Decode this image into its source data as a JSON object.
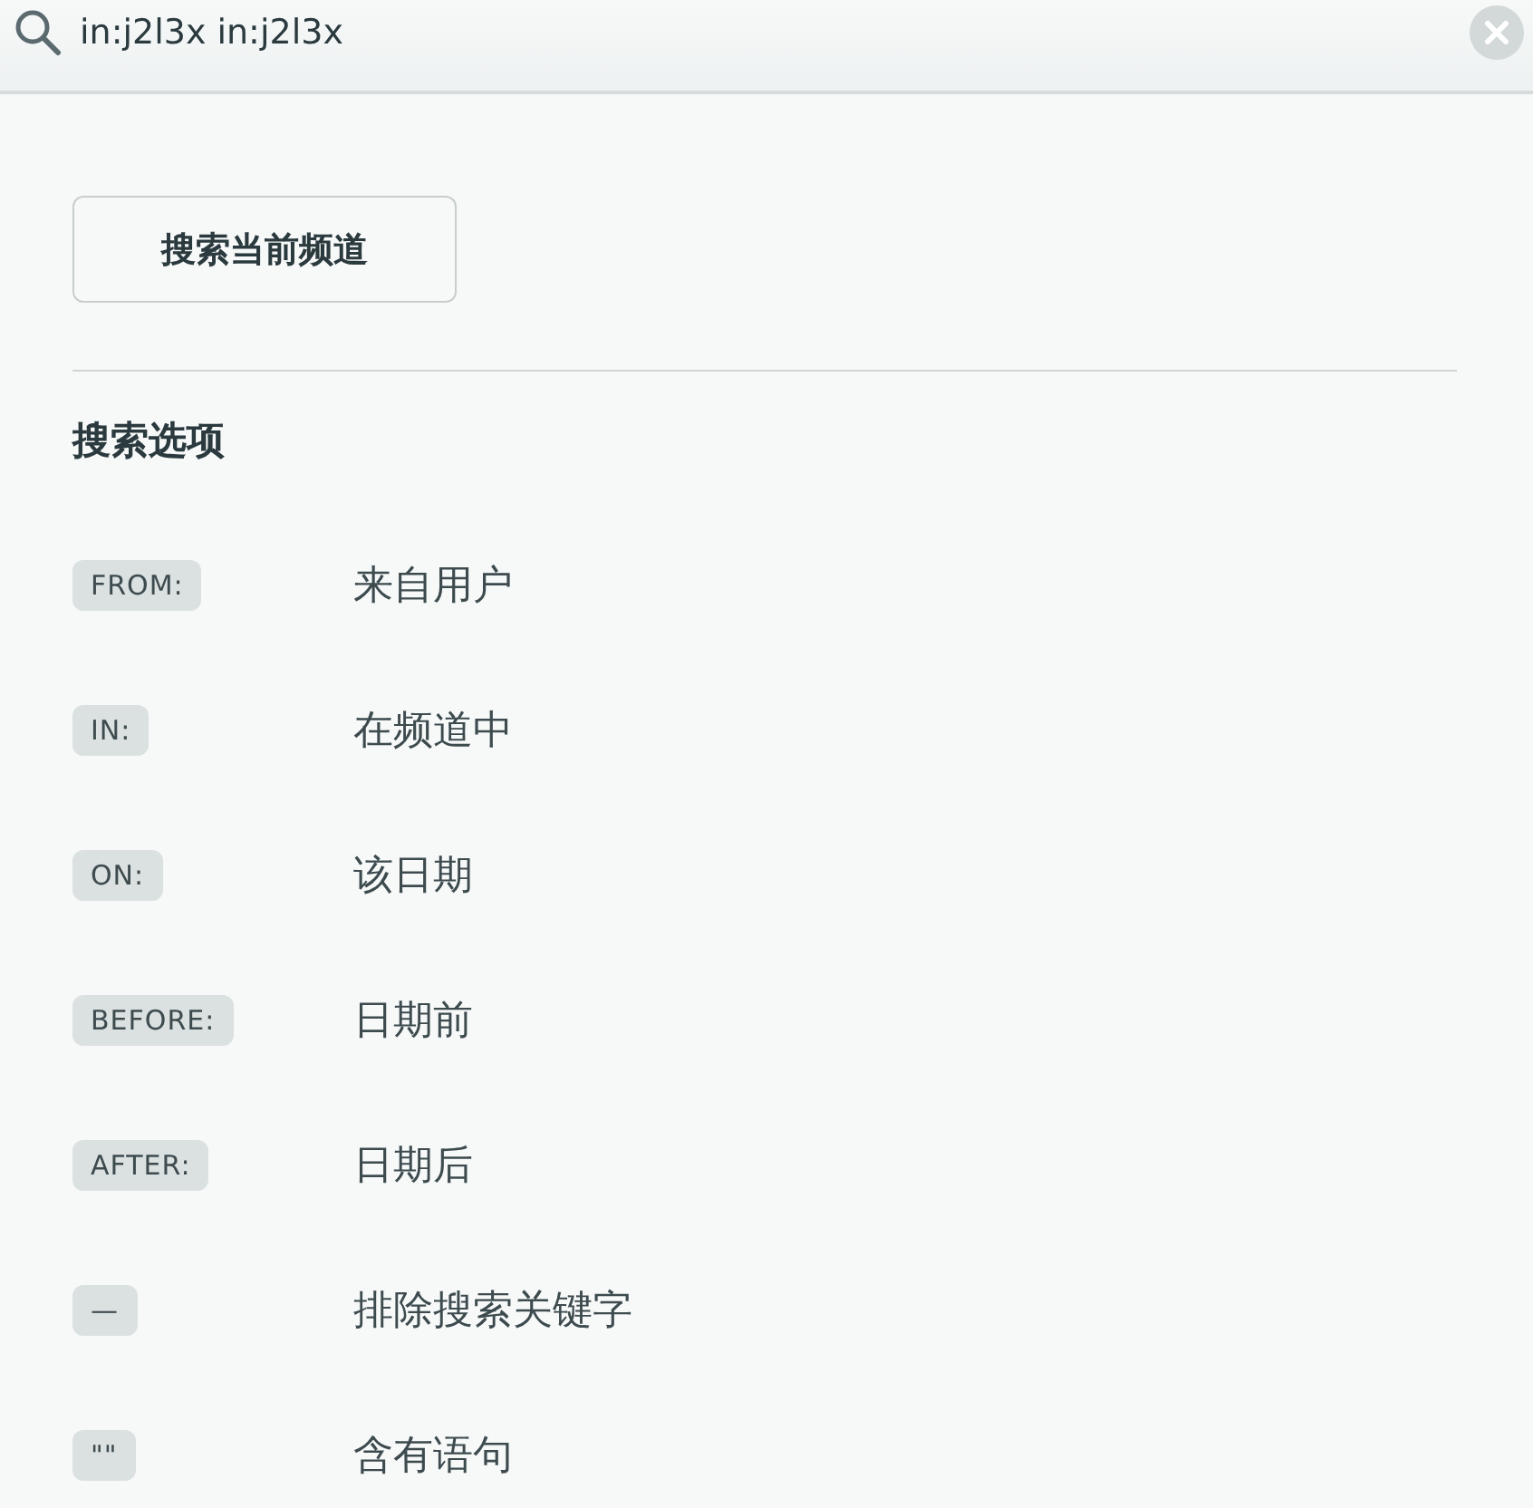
{
  "search": {
    "value": "in:j2l3x in:j2l3x"
  },
  "search_current_channel_button": "搜索当前频道",
  "options_heading": "搜索选项",
  "options": [
    {
      "modifier": "FROM:",
      "description": "来自用户"
    },
    {
      "modifier": "IN:",
      "description": "在频道中"
    },
    {
      "modifier": "ON:",
      "description": "该日期"
    },
    {
      "modifier": "BEFORE:",
      "description": "日期前"
    },
    {
      "modifier": "AFTER:",
      "description": "日期后"
    },
    {
      "modifier": "—",
      "description": "排除搜索关键字"
    },
    {
      "modifier": "\"\"",
      "description": "含有语句"
    }
  ]
}
